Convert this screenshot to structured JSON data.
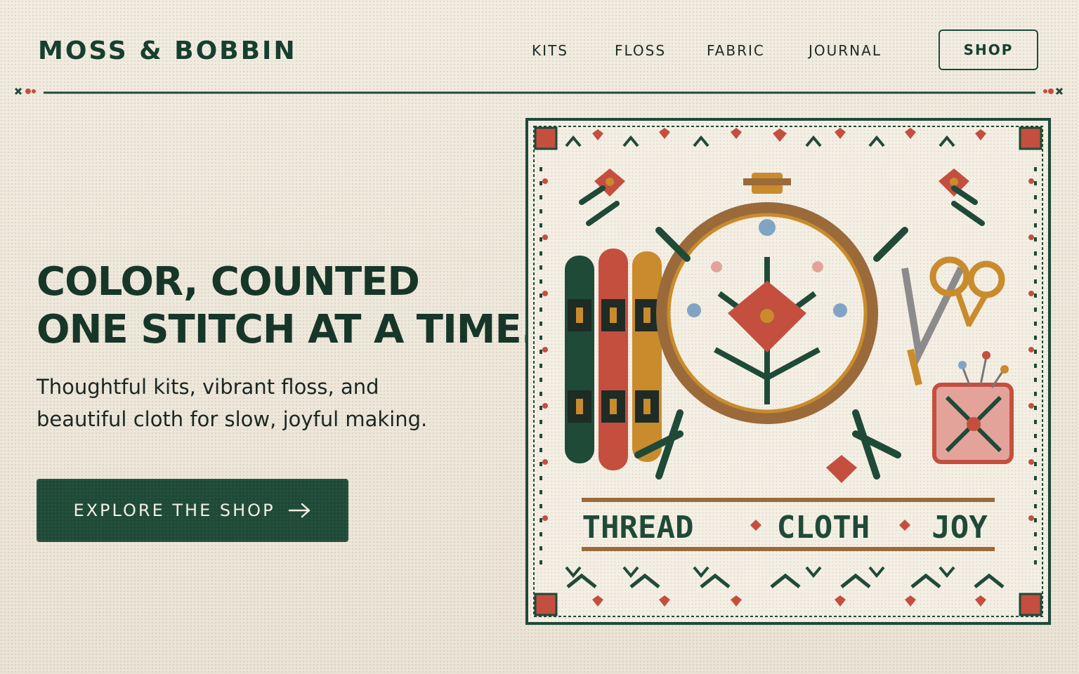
{
  "brand": {
    "name": "MOSS & BOBBIN"
  },
  "nav": {
    "items": [
      "KITS",
      "FLOSS",
      "FABRIC",
      "JOURNAL"
    ],
    "shop_label": "SHOP"
  },
  "hero": {
    "title_lines": [
      "COLOR, COUNTED",
      "ONE STITCH AT A TIME."
    ],
    "subtitle_lines": [
      "Thoughtful kits, vibrant floss, and",
      "beautiful cloth for slow, joyful making."
    ],
    "cta_label": "EXPLORE THE SHOP"
  },
  "artwork": {
    "words": [
      "THREAD",
      "CLOTH",
      "JOY"
    ],
    "colors": {
      "green": "#1f4a38",
      "red": "#c44f3f",
      "gold": "#c98b2c",
      "brown": "#9a6a3a",
      "pink": "#e3a39a",
      "blue": "#7fa4c4"
    }
  },
  "theme": {
    "accent": "#1f4a38",
    "background": "#efe8da",
    "text": "#17392b"
  }
}
